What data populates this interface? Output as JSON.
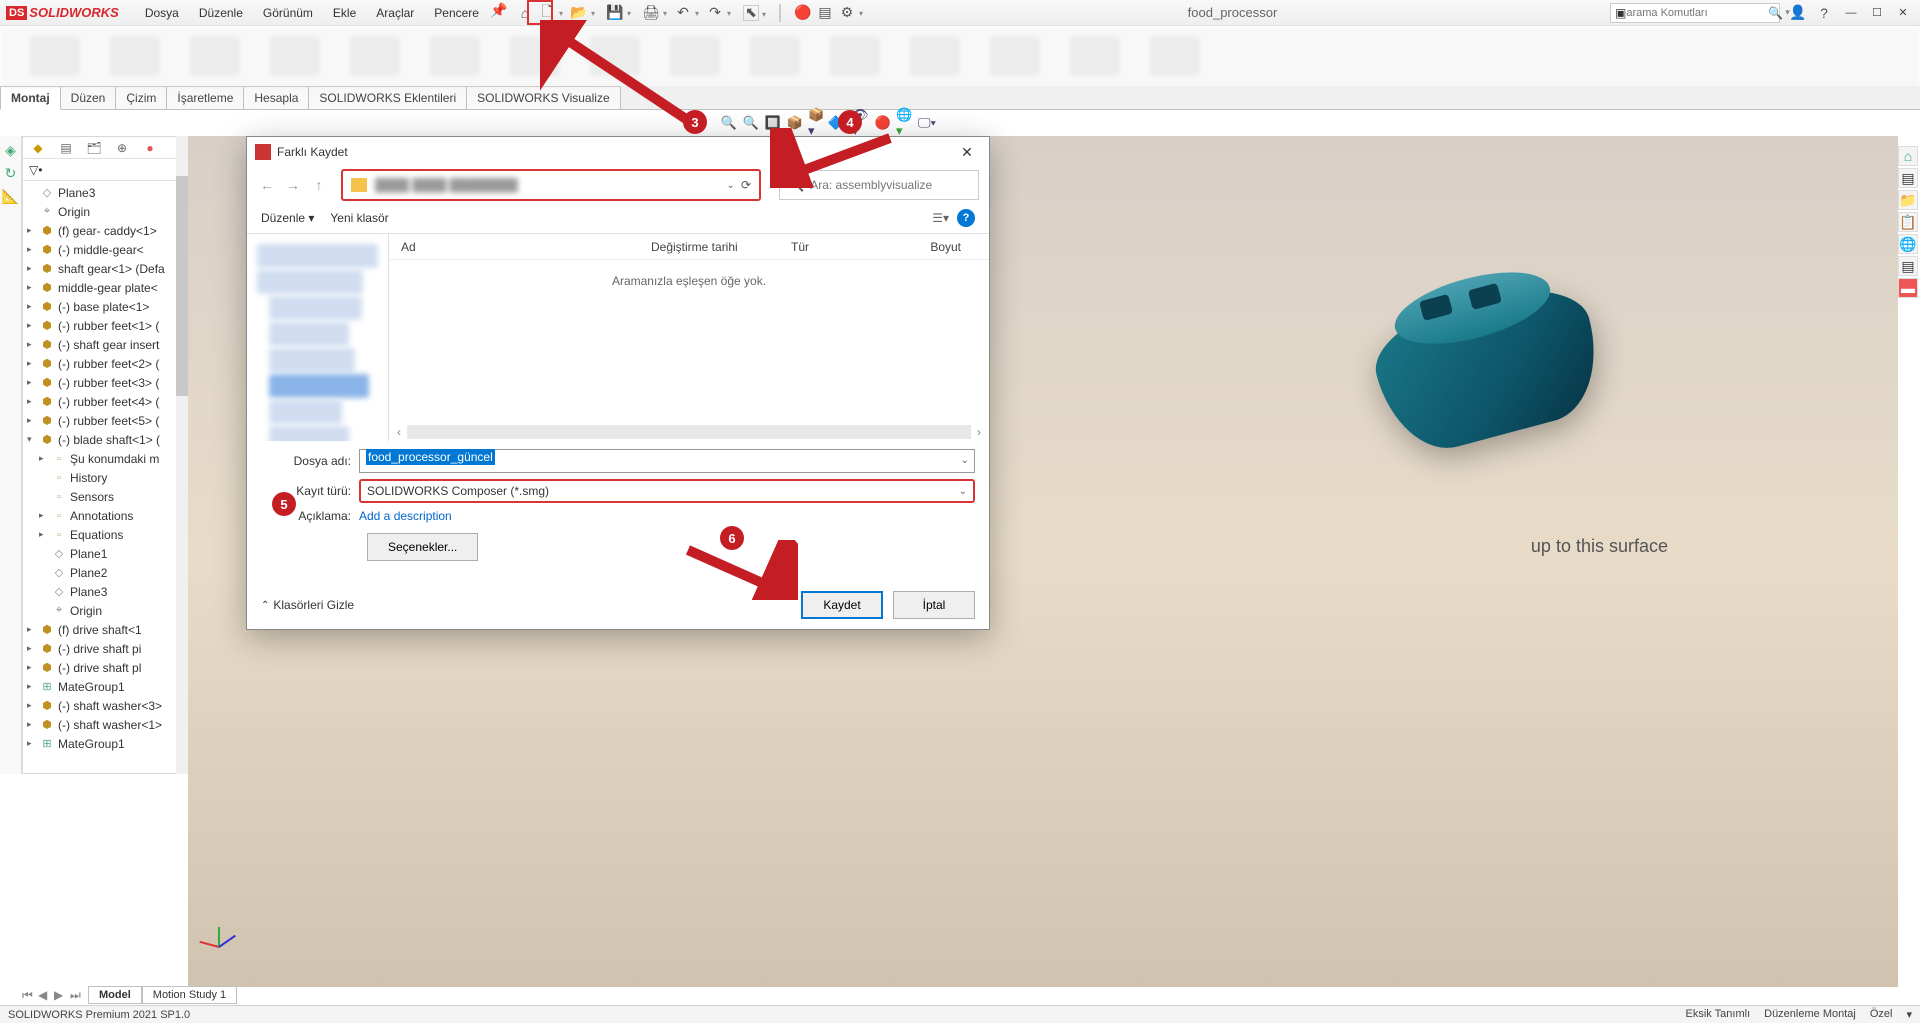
{
  "app": {
    "logo_prefix": "DS",
    "logo_text": "SOLIDWORKS",
    "doc_title": "food_processor",
    "search_placeholder": "arama Komutları"
  },
  "menu": [
    "Dosya",
    "Düzenle",
    "Görünüm",
    "Ekle",
    "Araçlar",
    "Pencere"
  ],
  "app_tabs": [
    "Montaj",
    "Düzen",
    "Çizim",
    "İşaretleme",
    "Hesapla",
    "SOLIDWORKS Eklentileri",
    "SOLIDWORKS Visualize"
  ],
  "tree": [
    {
      "level": 1,
      "exp": "",
      "icon": "plane",
      "label": "Plane3"
    },
    {
      "level": 1,
      "exp": "",
      "icon": "origin",
      "label": "Origin"
    },
    {
      "level": 1,
      "exp": "▸",
      "icon": "part",
      "label": "(f) gear- caddy<1>"
    },
    {
      "level": 1,
      "exp": "▸",
      "icon": "part",
      "label": "(-) middle-gear<"
    },
    {
      "level": 1,
      "exp": "▸",
      "icon": "part",
      "label": "shaft gear<1> (Defa"
    },
    {
      "level": 1,
      "exp": "▸",
      "icon": "part",
      "label": "middle-gear plate<"
    },
    {
      "level": 1,
      "exp": "▸",
      "icon": "part",
      "label": "(-) base plate<1>"
    },
    {
      "level": 1,
      "exp": "▸",
      "icon": "part",
      "label": "(-) rubber feet<1> ("
    },
    {
      "level": 1,
      "exp": "▸",
      "icon": "part",
      "label": "(-) shaft gear insert"
    },
    {
      "level": 1,
      "exp": "▸",
      "icon": "part",
      "label": "(-) rubber feet<2> ("
    },
    {
      "level": 1,
      "exp": "▸",
      "icon": "part",
      "label": "(-) rubber feet<3> ("
    },
    {
      "level": 1,
      "exp": "▸",
      "icon": "part",
      "label": "(-) rubber feet<4> ("
    },
    {
      "level": 1,
      "exp": "▸",
      "icon": "part",
      "label": "(-) rubber feet<5> ("
    },
    {
      "level": 1,
      "exp": "▾",
      "icon": "part",
      "label": "(-) blade shaft<1> ("
    },
    {
      "level": 2,
      "exp": "▸",
      "icon": "folder",
      "label": "Şu konumdaki m"
    },
    {
      "level": 2,
      "exp": "",
      "icon": "folder",
      "label": "History"
    },
    {
      "level": 2,
      "exp": "",
      "icon": "folder",
      "label": "Sensors"
    },
    {
      "level": 2,
      "exp": "▸",
      "icon": "folder",
      "label": "Annotations"
    },
    {
      "level": 2,
      "exp": "▸",
      "icon": "folder",
      "label": "Equations"
    },
    {
      "level": 2,
      "exp": "",
      "icon": "plane",
      "label": "Plane1"
    },
    {
      "level": 2,
      "exp": "",
      "icon": "plane",
      "label": "Plane2"
    },
    {
      "level": 2,
      "exp": "",
      "icon": "plane",
      "label": "Plane3"
    },
    {
      "level": 2,
      "exp": "",
      "icon": "origin",
      "label": "Origin"
    },
    {
      "level": 1,
      "exp": "▸",
      "icon": "part",
      "label": "(f) drive shaft<1"
    },
    {
      "level": 1,
      "exp": "▸",
      "icon": "part",
      "label": "(-) drive shaft pi"
    },
    {
      "level": 1,
      "exp": "▸",
      "icon": "part",
      "label": "(-) drive shaft pl"
    },
    {
      "level": 1,
      "exp": "▸",
      "icon": "mate",
      "label": "MateGroup1"
    },
    {
      "level": 1,
      "exp": "▸",
      "icon": "part",
      "label": "(-) shaft washer<3>"
    },
    {
      "level": 1,
      "exp": "▸",
      "icon": "part",
      "label": "(-) shaft washer<1>"
    },
    {
      "level": 1,
      "exp": "▸",
      "icon": "mate",
      "label": "MateGroup1"
    }
  ],
  "surface_text": "up to this surface",
  "dialog": {
    "title": "Farklı Kaydet",
    "search_placeholder": "Ara: assemblyvisualize",
    "organize": "Düzenle",
    "new_folder": "Yeni klasör",
    "columns": {
      "name": "Ad",
      "modified": "Değiştirme tarihi",
      "type": "Tür",
      "size": "Boyut"
    },
    "empty_msg": "Aramanızla eşleşen öğe yok.",
    "filename_label": "Dosya adı:",
    "filename_value": "food_processor_güncel",
    "filetype_label": "Kayıt türü:",
    "filetype_value": "SOLIDWORKS Composer (*.smg)",
    "description_label": "Açıklama:",
    "description_link": "Add a description",
    "options_btn": "Seçenekler...",
    "hide_folders": "Klasörleri Gizle",
    "save_btn": "Kaydet",
    "cancel_btn": "İptal"
  },
  "bottom_tabs": [
    "Model",
    "Motion Study 1"
  ],
  "status": {
    "left": "SOLIDWORKS Premium 2021 SP1.0",
    "right1": "Eksik Tanımlı",
    "right2": "Düzenleme Montaj",
    "right3": "Özel"
  },
  "annotations": {
    "n3": "3",
    "n4": "4",
    "n5": "5",
    "n6": "6"
  }
}
